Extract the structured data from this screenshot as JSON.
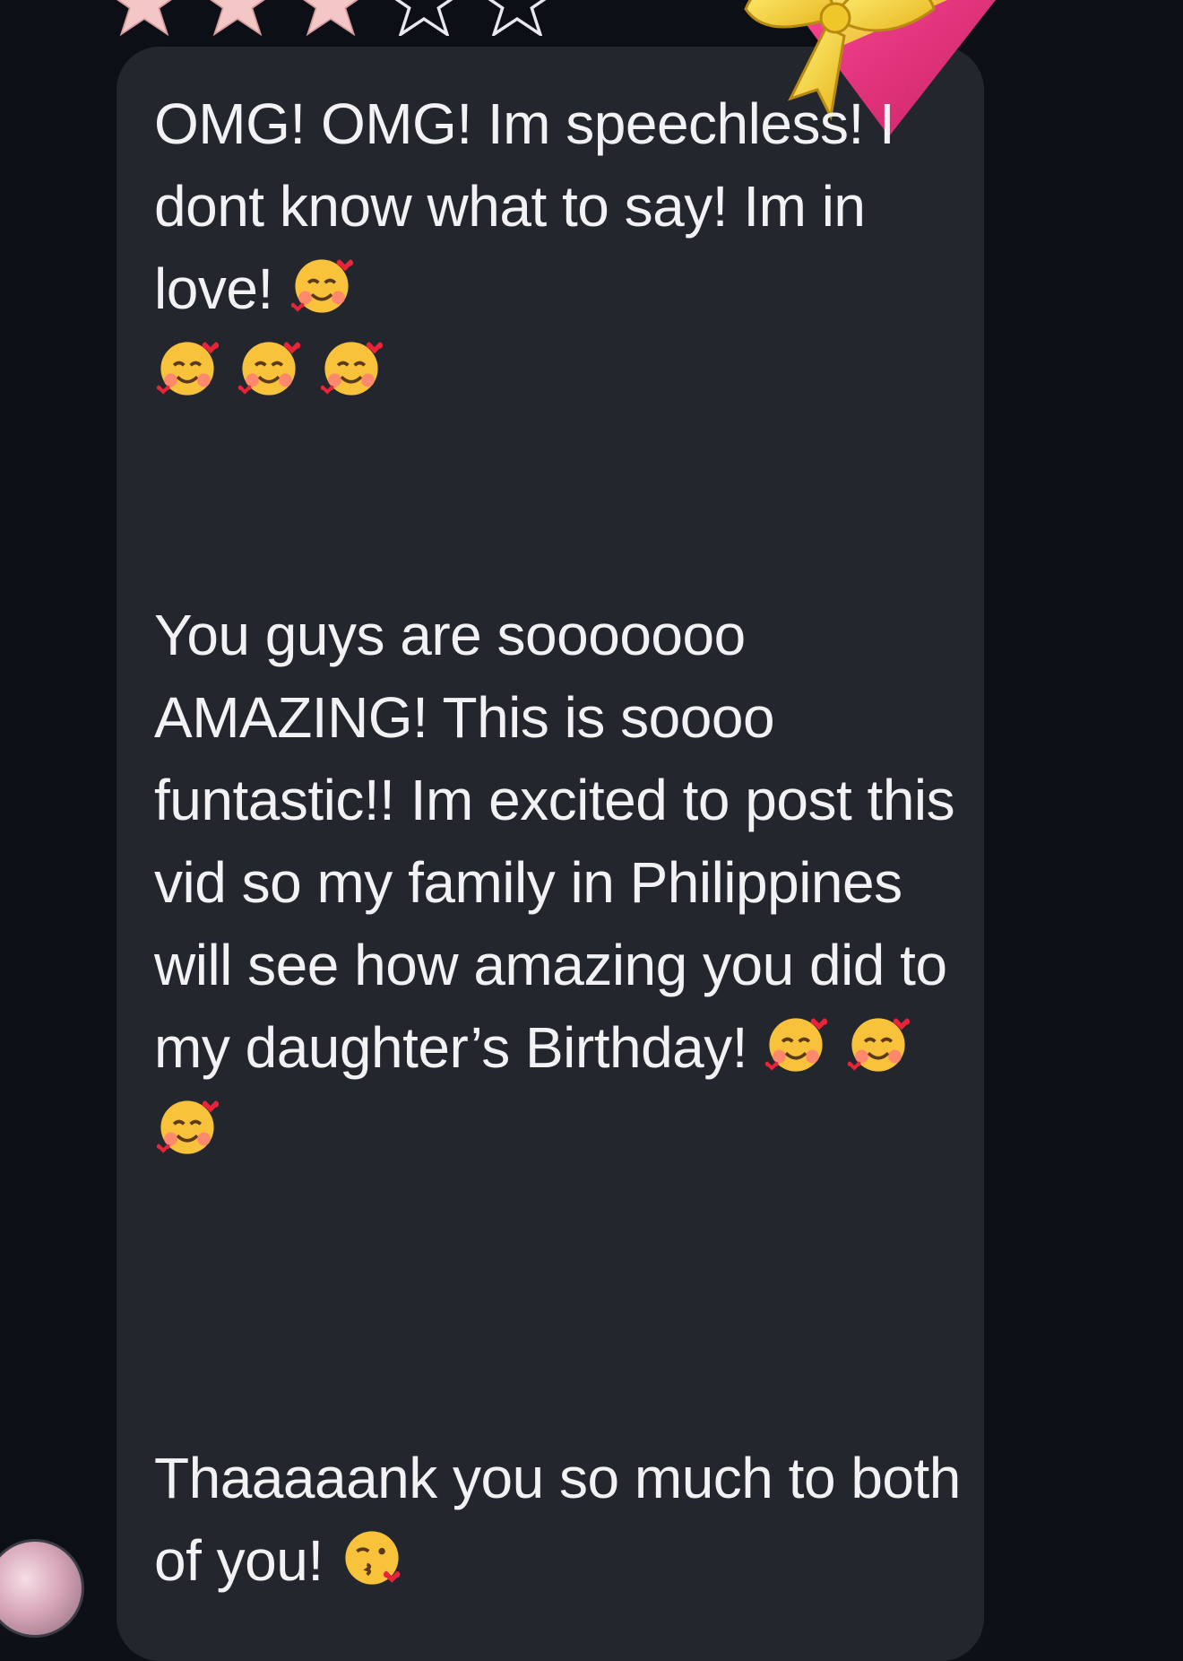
{
  "rating": {
    "filled": 3,
    "total": 5,
    "filled_color": "#f4c7c7",
    "empty_color": "#e8e8ee"
  },
  "message": {
    "paragraph_1": "OMG! OMG! Im speechless! I dont know what to say! Im in love!",
    "paragraph_2": "You guys are sooooooo AMAZING! This is soooo funtastic!! Im excited to post this vid so my family in Philippines will see how amazing you did to my daughter’s Birthday!",
    "paragraph_3": "Thaaaaank you so much to both of you!",
    "emoji_1": "smiling-face-with-hearts-icon",
    "emoji_2": "face-blowing-kiss-icon"
  },
  "sticker": {
    "icon": "gift-heart-icon",
    "ribbon_color": "#f7d73a",
    "box_color": "#e6297a"
  },
  "colors": {
    "background": "#0c0f16",
    "bubble": "#24262d",
    "text": "#f2f2f4"
  }
}
